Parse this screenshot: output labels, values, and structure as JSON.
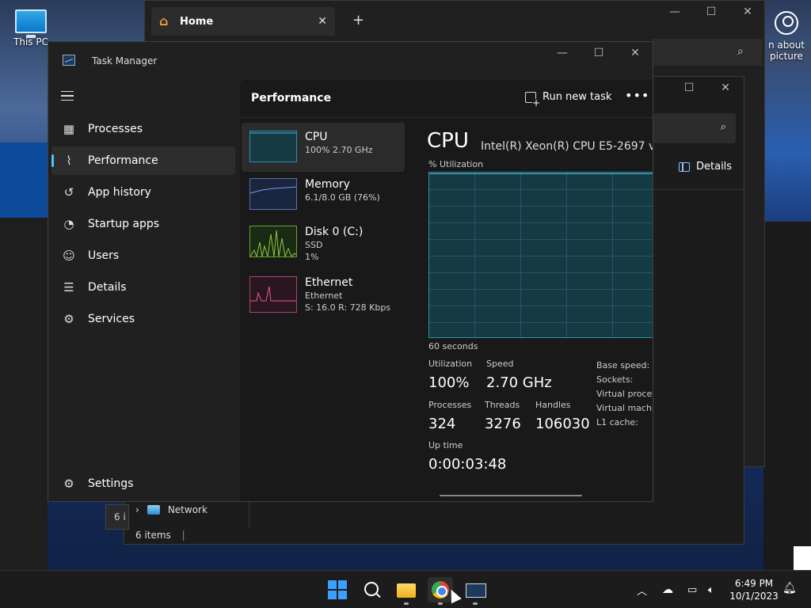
{
  "desktop": {
    "this_pc_label": "This PC",
    "about_label_line1": "n about",
    "about_label_line2": "picture"
  },
  "browser": {
    "tab_title": "Home",
    "tab_close": "✕",
    "new_tab": "+",
    "minimize": "—",
    "maximize": "☐",
    "close": "✕"
  },
  "explorer": {
    "details_label": "Details",
    "network_label": "Network",
    "status_items": "6 items",
    "hint_text": "6 i",
    "maximize": "☐",
    "close": "✕"
  },
  "task_manager": {
    "title": "Task Manager",
    "minimize": "—",
    "maximize": "☐",
    "close": "✕",
    "nav": [
      {
        "label": "Processes",
        "icon": "processes-icon"
      },
      {
        "label": "Performance",
        "icon": "performance-icon"
      },
      {
        "label": "App history",
        "icon": "history-icon"
      },
      {
        "label": "Startup apps",
        "icon": "startup-icon"
      },
      {
        "label": "Users",
        "icon": "users-icon"
      },
      {
        "label": "Details",
        "icon": "details-icon"
      },
      {
        "label": "Services",
        "icon": "services-icon"
      }
    ],
    "settings_label": "Settings",
    "page_title": "Performance",
    "run_new_task": "Run new task",
    "more": "•••",
    "perf_items": [
      {
        "name": "CPU",
        "sub1": "100%  2.70 GHz"
      },
      {
        "name": "Memory",
        "sub1": "6.1/8.0 GB (76%)"
      },
      {
        "name": "Disk 0 (C:)",
        "sub1": "SSD",
        "sub2": "1%"
      },
      {
        "name": "Ethernet",
        "sub1": "Ethernet",
        "sub2": "S: 16.0  R: 728 Kbps"
      }
    ],
    "detail": {
      "heading": "CPU",
      "cpu_name": "Intel(R) Xeon(R) CPU E5-2697 v",
      "util_label": "% Utilization",
      "time_span": "60 seconds",
      "utilization_label": "Utilization",
      "utilization_value": "100%",
      "speed_label": "Speed",
      "speed_value": "2.70 GHz",
      "processes_label": "Processes",
      "processes_value": "324",
      "threads_label": "Threads",
      "threads_value": "3276",
      "handles_label": "Handles",
      "handles_value": "106030",
      "uptime_label": "Up time",
      "uptime_value": "0:00:03:48",
      "base_speed_label": "Base speed:",
      "sockets_label": "Sockets:",
      "virtual_processors_label": "Virtual proces",
      "virtual_machine_label": "Virtual machi",
      "l1_cache_label": "L1 cache:",
      "utilization_percent": 100
    }
  },
  "taskbar": {
    "time": "6:49 PM",
    "date": "10/1/2023"
  },
  "colors": {
    "accent": "#4cc2ff",
    "cpu_graph_fill": "#163a44",
    "cpu_graph_line": "#4cb8d8",
    "memory_line": "#7d9ad8",
    "disk_line": "#8cc63f",
    "ethernet_line": "#e25a8c"
  }
}
